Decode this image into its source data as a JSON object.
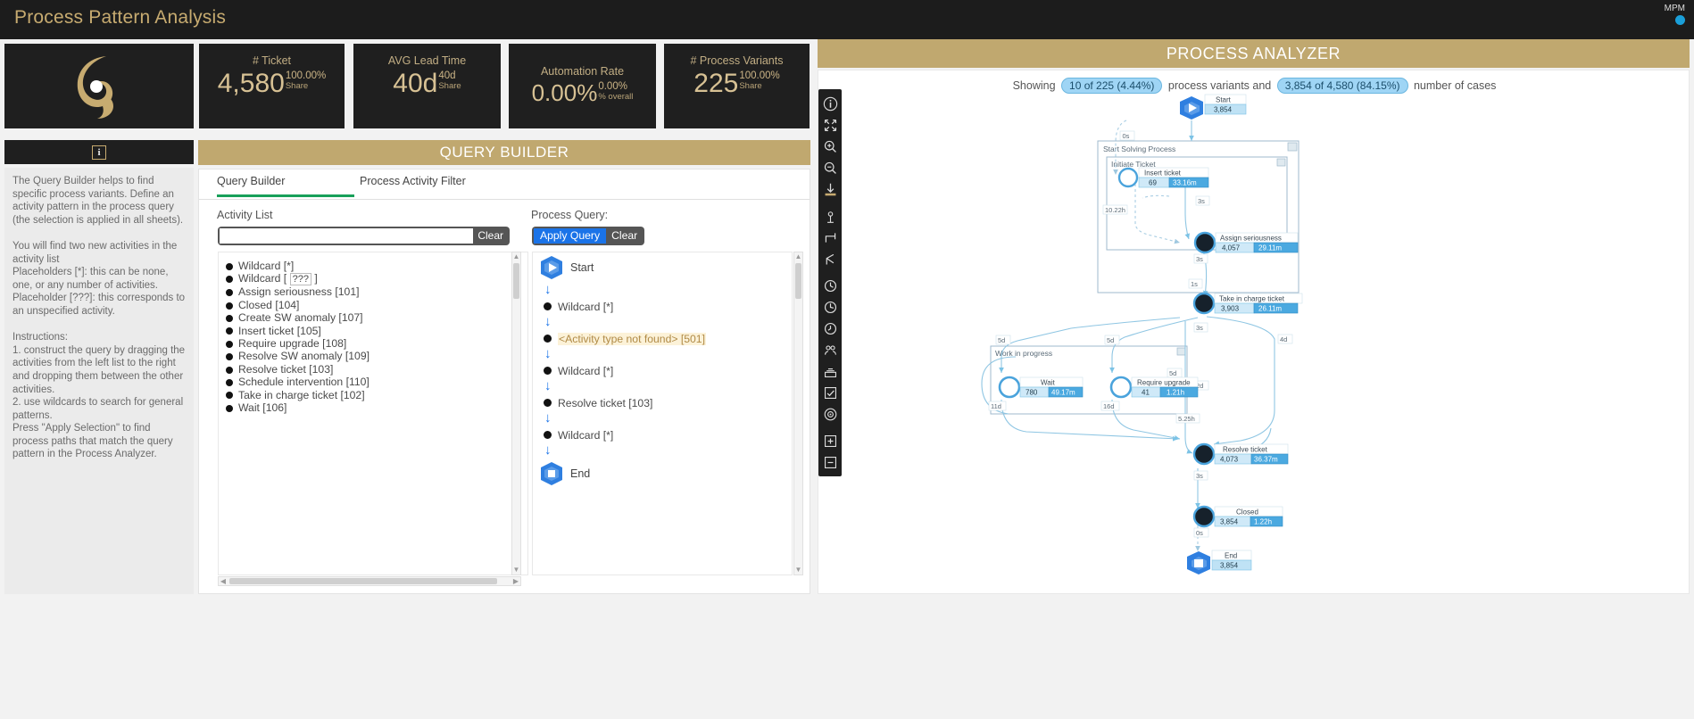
{
  "header": {
    "title": "Process Pattern Analysis",
    "brand": "MPM"
  },
  "kpis": [
    {
      "title": "# Ticket",
      "value": "4,580",
      "sub1": "100.00%",
      "sub2": "Share"
    },
    {
      "title": "AVG Lead Time",
      "value": "40d",
      "sub1": "40d",
      "sub2": "Share"
    },
    {
      "title": "Automation Rate",
      "value": "0.00%",
      "sub1": "0.00%",
      "sub2": "% overall"
    },
    {
      "title": "# Process Variants",
      "value": "225",
      "sub1": "100.00%",
      "sub2": "Share"
    }
  ],
  "info": {
    "badge": "i",
    "text": "The Query Builder helps to find specific process variants. Define an activity pattern in the process query (the selection is applied in all sheets).\n\nYou will find two new activities in the activity list\nPlaceholders [*]: this can be none, one, or any number of activities.\nPlaceholder [???]: this corresponds to an unspecified activity.\n\nInstructions:\n1. construct the query by dragging the activities from the left list to the right and dropping them between the other activities.\n2. use wildcards to search for general patterns.\nPress \"Apply Selection\" to find process paths that match the query pattern in the Process Analyzer."
  },
  "query_builder": {
    "header": "QUERY BUILDER",
    "tabs": [
      {
        "label": "Query Builder",
        "active": true
      },
      {
        "label": "Process Activity Filter",
        "active": false
      }
    ],
    "activity_list_label": "Activity List",
    "search": {
      "value": "",
      "placeholder": "",
      "clear_label": "Clear"
    },
    "activities": [
      "Wildcard [*]",
      "Wildcard [ ??? ]",
      "Assign seriousness [101]",
      "Closed [104]",
      "Create SW anomaly [107]",
      "Insert ticket [105]",
      "Require upgrade [108]",
      "Resolve SW anomaly [109]",
      "Resolve ticket [103]",
      "Schedule intervention [110]",
      "Take in charge ticket [102]",
      "Wait [106]"
    ],
    "process_query_label": "Process Query:",
    "apply_label": "Apply Query",
    "clear_label": "Clear",
    "query_chain": [
      {
        "type": "start",
        "label": "Start"
      },
      {
        "type": "activity",
        "label": "Wildcard [*]"
      },
      {
        "type": "notfound",
        "label": "<Activity type not found> [501]"
      },
      {
        "type": "activity",
        "label": "Wildcard [*]"
      },
      {
        "type": "activity",
        "label": "Resolve ticket [103]"
      },
      {
        "type": "activity",
        "label": "Wildcard [*]"
      },
      {
        "type": "end",
        "label": "End"
      }
    ]
  },
  "process_analyzer": {
    "header": "PROCESS ANALYZER",
    "showing_prefix": "Showing",
    "variants_pill": "10 of 225 (4.44%)",
    "showing_middle": "process variants and",
    "cases_pill": "3,854 of 4,580 (84.15%)",
    "showing_suffix": "number of cases",
    "toolbar": [
      "info-icon",
      "expand-icon",
      "zoom-in-icon",
      "zoom-out-icon",
      "download-icon",
      "palette-icon",
      "branch-icon",
      "fork-icon",
      "clock-icon",
      "clock-alt-icon",
      "clock-third-icon",
      "group-icon",
      "stack-icon",
      "checkbox-icon",
      "target-icon",
      "add-box-icon",
      "remove-box-icon"
    ],
    "containers": [
      {
        "label": "Start Solving Process"
      },
      {
        "label": "Initiate Ticket"
      },
      {
        "label": "Work in progress"
      }
    ],
    "nodes": [
      {
        "id": "start",
        "label": "Start",
        "count": "3,854",
        "metric": "",
        "type": "start"
      },
      {
        "id": "insert",
        "label": "Insert ticket",
        "count": "69",
        "metric": "33.16m",
        "type": "activity"
      },
      {
        "id": "assign",
        "label": "Assign seriousness",
        "count": "4,057",
        "metric": "29.11m",
        "type": "activity"
      },
      {
        "id": "take",
        "label": "Take in charge ticket",
        "count": "3,903",
        "metric": "26.11m",
        "type": "activity"
      },
      {
        "id": "wait",
        "label": "Wait",
        "count": "780",
        "metric": "49.17m",
        "type": "activity"
      },
      {
        "id": "require",
        "label": "Require upgrade",
        "count": "41",
        "metric": "1.21h",
        "type": "activity"
      },
      {
        "id": "resolve",
        "label": "Resolve ticket",
        "count": "4,073",
        "metric": "36.37m",
        "type": "activity"
      },
      {
        "id": "closed",
        "label": "Closed",
        "count": "3,854",
        "metric": "1.22h",
        "type": "activity"
      },
      {
        "id": "end",
        "label": "End",
        "count": "3,854",
        "metric": "",
        "type": "end"
      }
    ],
    "edges": [
      {
        "label": "0s"
      },
      {
        "label": "10.22h"
      },
      {
        "label": "3s"
      },
      {
        "label": "3s"
      },
      {
        "label": "3s"
      },
      {
        "label": "5d"
      },
      {
        "label": "5d"
      },
      {
        "label": "4d"
      },
      {
        "label": "5d"
      },
      {
        "label": "11d"
      },
      {
        "label": "16d"
      },
      {
        "label": "5.25h"
      },
      {
        "label": "2d"
      },
      {
        "label": "3s"
      },
      {
        "label": "0s"
      },
      {
        "label": "1s"
      }
    ]
  },
  "colors": {
    "gold": "#c0a86f",
    "dark": "#1f1f1f",
    "accent_blue": "#1a73e8",
    "pill_blue": "#9fd5f5",
    "tab_green": "#18a05a"
  }
}
